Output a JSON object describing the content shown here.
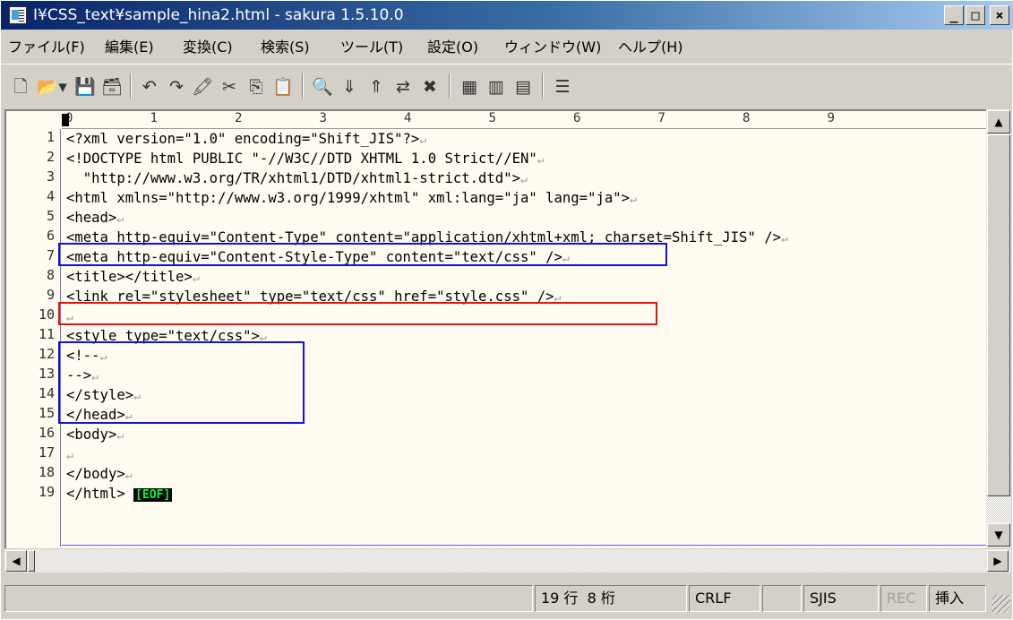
{
  "window": {
    "title": "I¥CSS_text¥sample_hina2.html - sakura 1.5.10.0",
    "min_label": "_",
    "max_label": "□",
    "close_label": "×"
  },
  "menu": [
    {
      "label": "ファイル(F)"
    },
    {
      "label": "編集(E)"
    },
    {
      "label": "変換(C)"
    },
    {
      "label": "検索(S)"
    },
    {
      "label": "ツール(T)"
    },
    {
      "label": "設定(O)"
    },
    {
      "label": "ウィンドウ(W)"
    },
    {
      "label": "ヘルプ(H)"
    }
  ],
  "toolbar": [
    {
      "icon": "new-file-icon",
      "glyph": "🗋"
    },
    {
      "icon": "open-folder-icon",
      "glyph": "📂"
    },
    {
      "icon": "dropdown-arrow-icon",
      "glyph": "▾"
    },
    {
      "icon": "save-icon",
      "glyph": "💾"
    },
    {
      "icon": "save-all-icon",
      "glyph": "🗃"
    },
    {
      "icon": "undo-icon",
      "glyph": "↶"
    },
    {
      "icon": "redo-icon",
      "glyph": "↷"
    },
    {
      "icon": "highlight-icon",
      "glyph": "🖍"
    },
    {
      "icon": "cut-icon",
      "glyph": "✂"
    },
    {
      "icon": "copy-icon",
      "glyph": "⎘"
    },
    {
      "icon": "paste-icon",
      "glyph": "📋"
    },
    {
      "icon": "find-icon",
      "glyph": "🔍"
    },
    {
      "icon": "find-next-icon",
      "glyph": "⇓"
    },
    {
      "icon": "find-prev-icon",
      "glyph": "⇑"
    },
    {
      "icon": "replace-icon",
      "glyph": "⇄"
    },
    {
      "icon": "clear-mark-icon",
      "glyph": "✖"
    },
    {
      "icon": "grep-icon",
      "glyph": "▦"
    },
    {
      "icon": "compare-icon",
      "glyph": "▥"
    },
    {
      "icon": "outline-icon",
      "glyph": "▤"
    },
    {
      "icon": "settings-icon",
      "glyph": "☰"
    }
  ],
  "ruler": [
    "0",
    "1",
    "2",
    "3",
    "4",
    "5",
    "6",
    "7",
    "8",
    "9"
  ],
  "lines": [
    "<?xml version=\"1.0\" encoding=\"Shift_JIS\"?>",
    "<!DOCTYPE html PUBLIC \"-//W3C//DTD XHTML 1.0 Strict//EN\"",
    "  \"http://www.w3.org/TR/xhtml1/DTD/xhtml1-strict.dtd\">",
    "<html xmlns=\"http://www.w3.org/1999/xhtml\" xml:lang=\"ja\" lang=\"ja\">",
    "<head>",
    "<meta http-equiv=\"Content-Type\" content=\"application/xhtml+xml; charset=Shift_JIS\" />",
    "<meta http-equiv=\"Content-Style-Type\" content=\"text/css\" />",
    "<title></title>",
    "<link rel=\"stylesheet\" type=\"text/css\" href=\"style.css\" />",
    "",
    "<style type=\"text/css\">",
    "<!--",
    "-->",
    "</style>",
    "</head>",
    "<body>",
    "",
    "</body>",
    "</html>"
  ],
  "return_mark": "↵",
  "eof_label": "[EOF]",
  "status": {
    "line": "19 行",
    "col": "8 桁",
    "newline": "CRLF",
    "encoding": "SJIS",
    "rec": "REC",
    "mode": "挿入"
  },
  "colors": {
    "highlight_blue": "#1010e8",
    "highlight_red": "#e81010",
    "editor_bg": "#fffbf0",
    "eof_fg": "#00ff40"
  }
}
